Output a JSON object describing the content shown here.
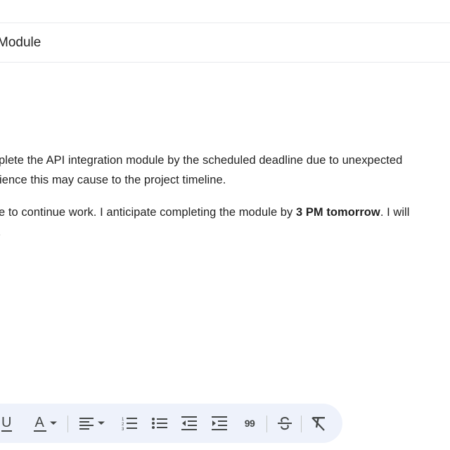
{
  "compose": {
    "subject": "Module",
    "body": {
      "line1": "plete the API integration module by the scheduled deadline due to unexpected",
      "line2": "ience this may cause to the project timeline.",
      "line3_before": "e to continue work. I anticipate completing the module by ",
      "line3_bold": "3 PM tomorrow",
      "line3_after": ". I will",
      "line4": "."
    }
  },
  "formatting_toolbar": {
    "underline_label": "U",
    "text_color_label": "A",
    "quote_label": "99",
    "icons": [
      "underline-icon",
      "text-color-icon",
      "align-icon",
      "numbered-list-icon",
      "bulleted-list-icon",
      "indent-less-icon",
      "indent-more-icon",
      "quote-icon",
      "strikethrough-icon",
      "remove-formatting-icon"
    ]
  }
}
